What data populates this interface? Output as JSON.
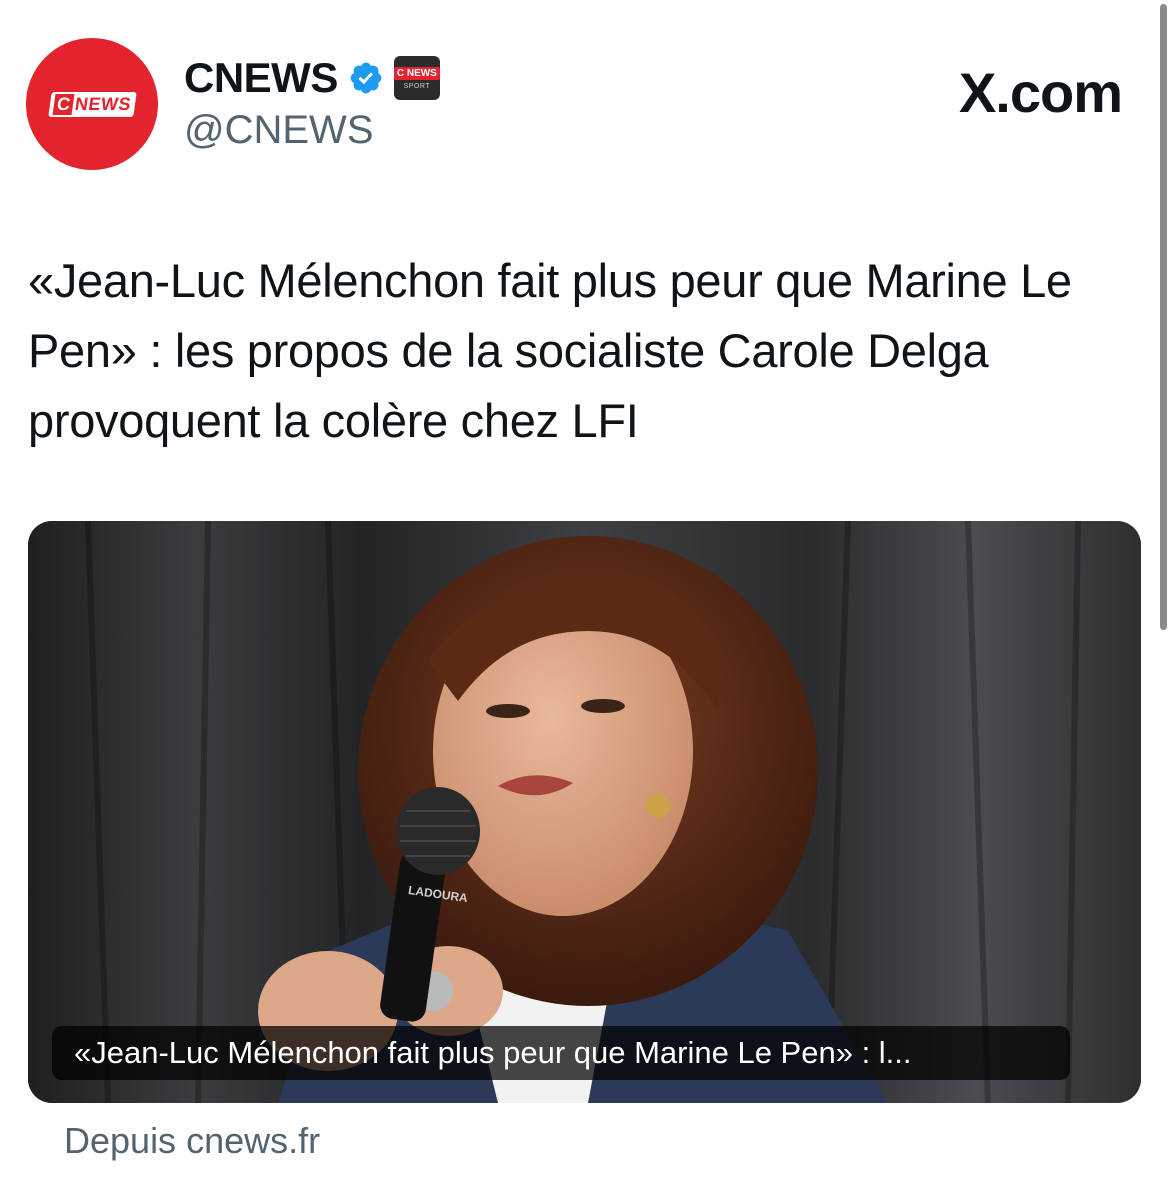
{
  "author": {
    "avatar_logo": {
      "c": "C",
      "news": "NEWS"
    },
    "name": "CNEWS",
    "handle": "@CNEWS",
    "affiliate_badge": {
      "line1": "C NEWS",
      "line2": "SPORT"
    }
  },
  "site_label": "X.com",
  "tweet": {
    "text": "«Jean-Luc Mélenchon fait plus peur que Marine Le Pen» : les propos de la socialiste Carole Delga provoquent la colère chez LFI"
  },
  "link_card": {
    "caption": "«Jean-Luc Mélenchon fait plus peur que Marine Le Pen» : l...",
    "mic_brand": "LADOURA",
    "source": "Depuis cnews.fr"
  },
  "icons": {
    "verified": "verified-badge-icon",
    "affiliate": "cnews-sport-affiliate-icon"
  },
  "colors": {
    "brand_red": "#e3232d",
    "verified_blue": "#1d9bf0",
    "text_primary": "#0f1419",
    "text_secondary": "#536471"
  }
}
